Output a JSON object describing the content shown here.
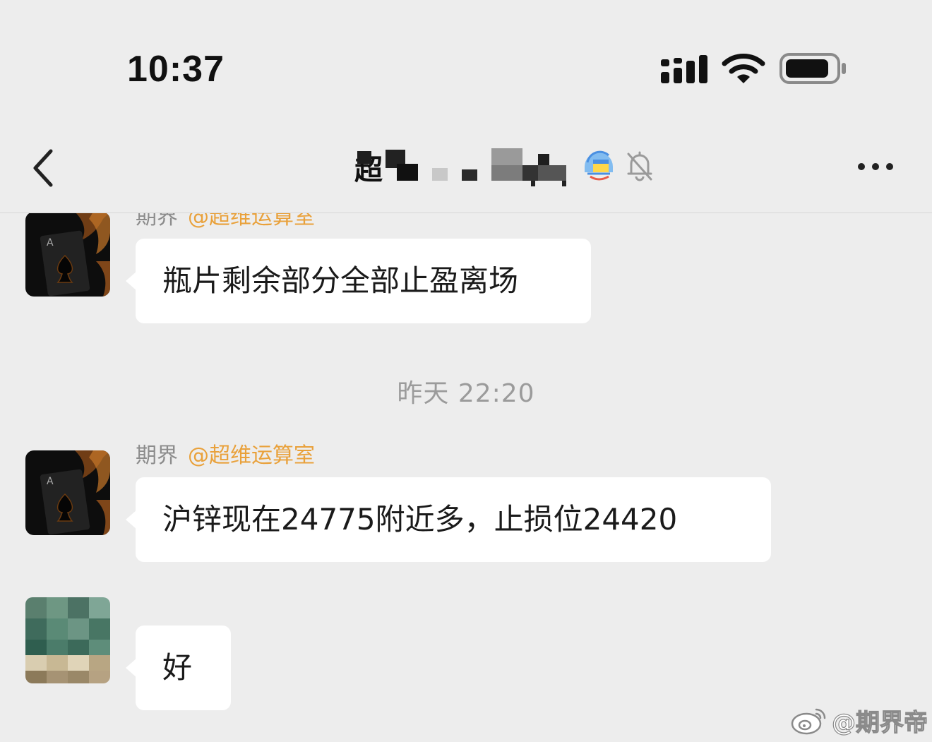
{
  "status_bar": {
    "time": "10:37",
    "signal_icon": "cellular-signal-icon",
    "wifi_icon": "wifi-icon",
    "battery_icon": "battery-icon"
  },
  "nav": {
    "back_icon": "chevron-left-icon",
    "title_visible_char": "超",
    "title_obscured": true,
    "group_badge_icon": "group-badge-icon",
    "mute_icon": "bell-slash-icon",
    "more_icon": "ellipsis-icon"
  },
  "messages": [
    {
      "sender": "期界",
      "mention": "@超维运算室",
      "text": "瓶片剩余部分全部止盈离场"
    },
    {
      "timestamp": "昨天 22:20"
    },
    {
      "sender": "期界",
      "mention": "@超维运算室",
      "text": "沪锌现在24775附近多，止损位24420"
    },
    {
      "sender": "",
      "avatar_obscured": true,
      "text": "好"
    }
  ],
  "watermark": {
    "icon": "weibo-icon",
    "text": "@期界帝"
  },
  "colors": {
    "background": "#ededed",
    "bubble": "#ffffff",
    "mention": "#e9a13b",
    "sender_name": "#8c8c8c",
    "timestamp": "#9b9b9b"
  }
}
